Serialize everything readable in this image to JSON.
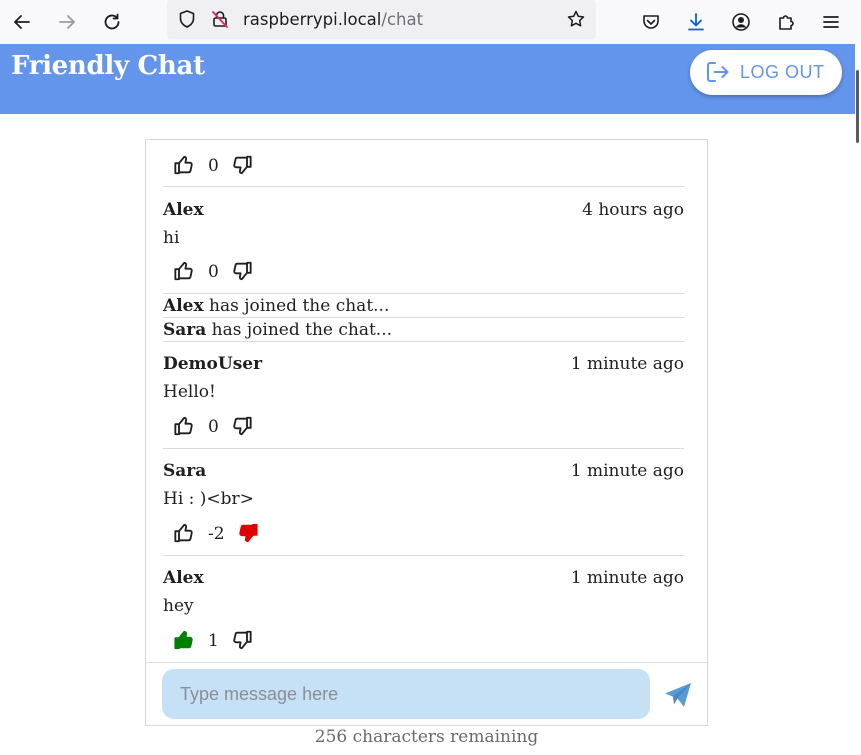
{
  "browser": {
    "url_host": "raspberrypi.local",
    "url_path": "/chat"
  },
  "header": {
    "title": "Friendly Chat",
    "logout_label": "LOG OUT"
  },
  "messages": [
    {
      "author": "",
      "time": "",
      "text": "",
      "votes": "0",
      "vote_state": "none"
    },
    {
      "author": "Alex",
      "time": "4 hours ago",
      "text": "hi",
      "votes": "0",
      "vote_state": "none"
    },
    {
      "author": "DemoUser",
      "time": "1 minute ago",
      "text": "Hello!",
      "votes": "0",
      "vote_state": "none"
    },
    {
      "author": "Sara",
      "time": "1 minute ago",
      "text": "Hi : )<br>",
      "votes": "-2",
      "vote_state": "down"
    },
    {
      "author": "Alex",
      "time": "1 minute ago",
      "text": "hey",
      "votes": "1",
      "vote_state": "up"
    }
  ],
  "events": [
    {
      "name": "Alex",
      "text": " has joined the chat..."
    },
    {
      "name": "Sara",
      "text": " has joined the chat..."
    }
  ],
  "composer": {
    "placeholder": "Type message here",
    "remaining": "256 characters remaining"
  },
  "colors": {
    "header_bg": "#6495ed",
    "upvote_active": "#008000",
    "downvote_active": "#e00000",
    "input_bg": "#c6e0f5"
  },
  "icons": {
    "back": "arrow-left-icon",
    "forward": "arrow-right-icon",
    "reload": "reload-icon",
    "logout": "logout-icon",
    "upvote": "thumbs-up-icon",
    "downvote": "thumbs-down-icon",
    "send": "send-icon"
  }
}
